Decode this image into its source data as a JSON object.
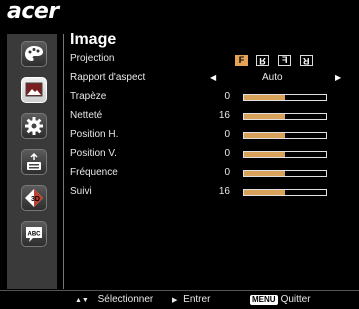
{
  "brand": "acer",
  "menu": {
    "title": "Image",
    "rows": [
      {
        "label": "Projection"
      },
      {
        "label": "Rapport d'aspect",
        "value": "Auto"
      },
      {
        "label": "Trapèze",
        "value": "0",
        "level": 0.5
      },
      {
        "label": "Netteté",
        "value": "16",
        "level": 0.5
      },
      {
        "label": "Position H.",
        "value": "0",
        "level": 0.5
      },
      {
        "label": "Position V.",
        "value": "0",
        "level": 0.5
      },
      {
        "label": "Fréquence",
        "value": "0",
        "level": 0.5
      },
      {
        "label": "Suivi",
        "value": "16",
        "level": 0.5
      }
    ],
    "projection_icons": [
      "F",
      "R",
      "F",
      "R"
    ],
    "projection_selected": 0
  },
  "sidebar": {
    "items": [
      {
        "icon": "palette-icon"
      },
      {
        "icon": "image-icon",
        "active": true
      },
      {
        "icon": "gear-icon"
      },
      {
        "icon": "audio-settings-icon"
      },
      {
        "icon": "3d-icon"
      },
      {
        "icon": "language-icon",
        "text": "ABC"
      }
    ]
  },
  "footer": {
    "select_label": "Sélectionner",
    "enter_label": "Entrer",
    "menu_key": "MENU",
    "quit_label": "Quitter"
  },
  "colors": {
    "accent": "#d9a25a",
    "sidebar_bg": "#3a3a3a"
  }
}
